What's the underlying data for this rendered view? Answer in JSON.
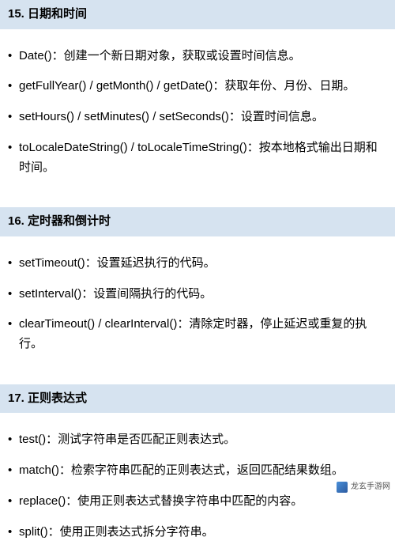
{
  "sections": [
    {
      "title": "15. 日期和时间",
      "items": [
        "Date()：创建一个新日期对象，获取或设置时间信息。",
        "getFullYear() / getMonth() / getDate()：获取年份、月份、日期。",
        "setHours() / setMinutes() / setSeconds()：设置时间信息。",
        "toLocaleDateString() / toLocaleTimeString()：按本地格式输出日期和时间。"
      ]
    },
    {
      "title": "16. 定时器和倒计时",
      "items": [
        "setTimeout()：设置延迟执行的代码。",
        "setInterval()：设置间隔执行的代码。",
        "clearTimeout() / clearInterval()：清除定时器，停止延迟或重复的执行。"
      ]
    },
    {
      "title": "17. 正则表达式",
      "items": [
        "test()：测试字符串是否匹配正则表达式。",
        "match()：检索字符串匹配的正则表达式，返回匹配结果数组。",
        "replace()：使用正则表达式替换字符串中匹配的内容。",
        "split()：使用正则表达式拆分字符串。"
      ]
    }
  ],
  "watermark": "龙玄手游网"
}
